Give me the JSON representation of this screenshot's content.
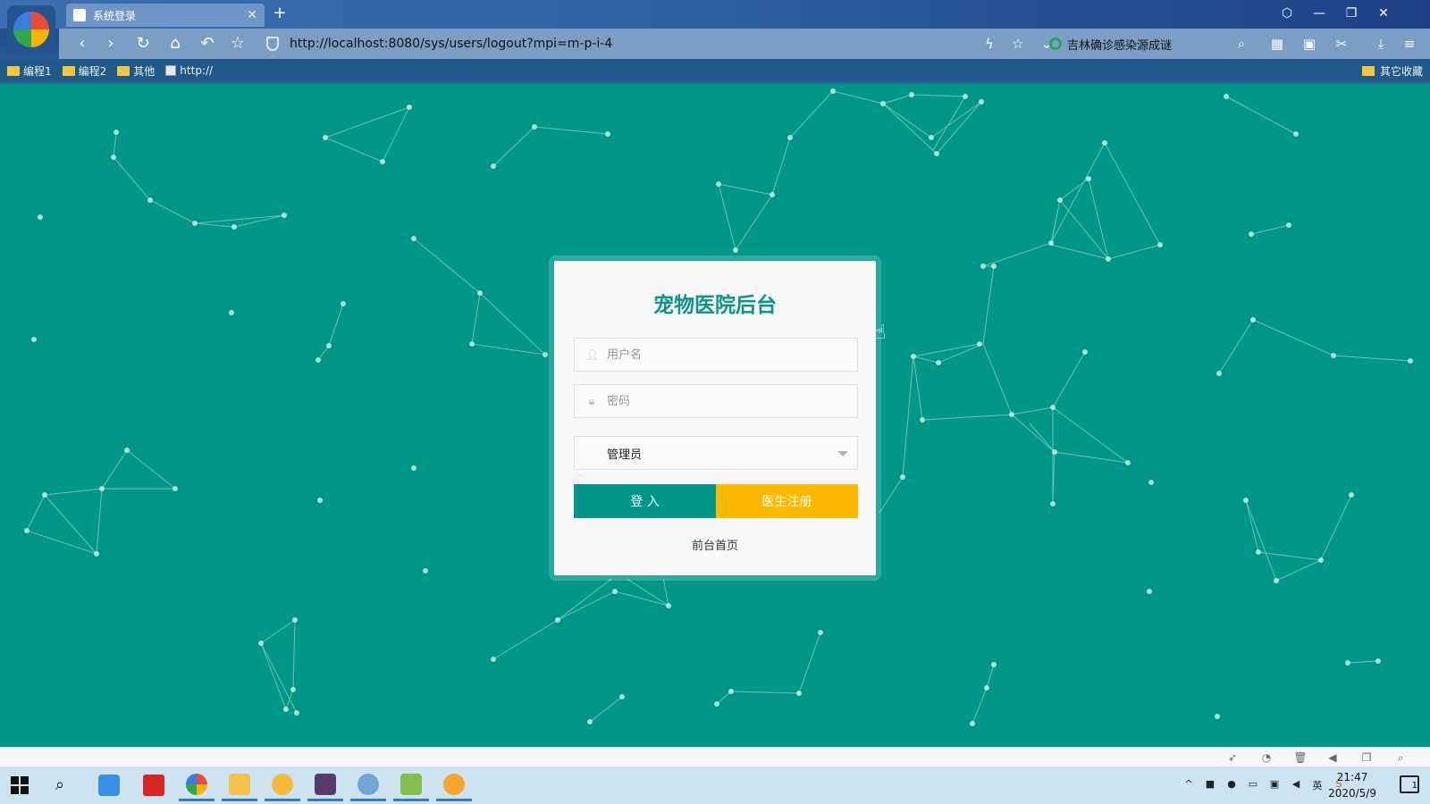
{
  "browser": {
    "tab_title": "系统登录",
    "url": "http://localhost:8080/sys/users/logout?mpi=m-p-i-4",
    "news_text": "吉林确诊感染源成谜",
    "bookmarks": [
      {
        "label": "编程1",
        "icon": "folder-icon"
      },
      {
        "label": "编程2",
        "icon": "folder-icon"
      },
      {
        "label": "其他",
        "icon": "folder-icon"
      },
      {
        "label": "http://",
        "icon": "page-icon"
      }
    ],
    "other_bookmarks": "其它收藏"
  },
  "login": {
    "title": "宠物医院后台",
    "username_placeholder": "用户名",
    "password_placeholder": "密码",
    "role_selected": "管理员",
    "login_label": "登 入",
    "register_label": "医生注册",
    "home_link": "前台首页",
    "accent_color": "#009688",
    "secondary_color": "#FFB800"
  },
  "taskbar": {
    "time": "21:47",
    "date": "2020/5/9",
    "notification_count": "1"
  }
}
